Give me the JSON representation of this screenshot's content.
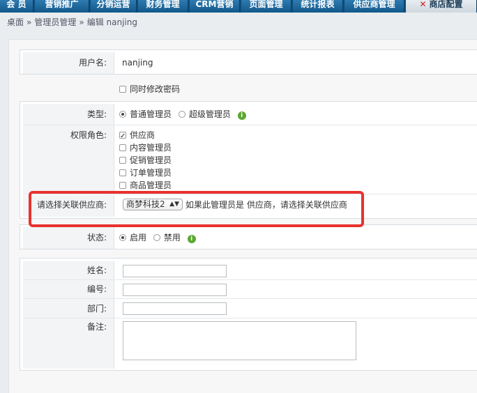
{
  "nav": {
    "tabs": [
      "会 员",
      "营销推广",
      "分销运营",
      "财务管理",
      "CRM营销",
      "页面管理",
      "统计报表",
      "供应商管理",
      "商店配置"
    ]
  },
  "breadcrumb": {
    "home": "桌面",
    "sep": "»",
    "level1": "管理员管理",
    "current": "编辑 nanjing"
  },
  "form": {
    "username_label": "用户名:",
    "username_value": "nanjing",
    "change_password_label": "同时修改密码",
    "type_label": "类型:",
    "type_normal": "普通管理员",
    "type_super": "超级管理员",
    "roles_label": "权限角色:",
    "roles": [
      "供应商",
      "内容管理员",
      "促销管理员",
      "订单管理员",
      "商品管理员"
    ],
    "supplier_label": "请选择关联供应商:",
    "supplier_selected": "商梦科技2",
    "supplier_hint": "如果此管理员是 供应商，请选择关联供应商",
    "status_label": "状态:",
    "status_on": "启用",
    "status_off": "禁用",
    "name_label": "姓名:",
    "number_label": "编号:",
    "dept_label": "部门:",
    "notes_label": "备注:"
  },
  "colors": {
    "nav_bg": "#0d4f7d",
    "highlight": "#e8322f",
    "info_icon": "#5aa830"
  }
}
